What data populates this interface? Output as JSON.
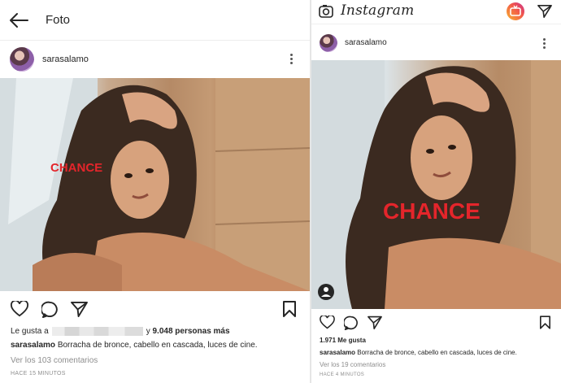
{
  "left": {
    "header": {
      "title": "Foto",
      "back_icon": "arrow-left-icon"
    },
    "post": {
      "username": "sarasalamo",
      "watermark": "CHANCE",
      "likes_prefix": "Le gusta a",
      "likes_suffix": "y",
      "likes_count": "9.048 personas más",
      "caption_user": "sarasalamo",
      "caption_text": "Borracha de bronce, cabello en cascada, luces de cine.",
      "comments_link": "Ver los 103 comentarios",
      "timestamp": "HACE 15 MINUTOS"
    }
  },
  "right": {
    "header": {
      "app_name": "Instagram",
      "camera_icon": "camera-icon",
      "igtv_icon": "igtv-icon",
      "direct_icon": "paper-plane-icon"
    },
    "post": {
      "username": "sarasalamo",
      "watermark": "CHANCE",
      "likes": "1.971 Me gusta",
      "caption_user": "sarasalamo",
      "caption_text": "Borracha de bronce, cabello en cascada, luces de cine.",
      "comments_link": "Ver los 19 comentarios",
      "timestamp": "HACE 4 MINUTOS"
    }
  },
  "colors": {
    "watermark": "#e4252b",
    "text": "#262626",
    "muted": "#8e8e8e",
    "igtv": "#f2564b"
  }
}
